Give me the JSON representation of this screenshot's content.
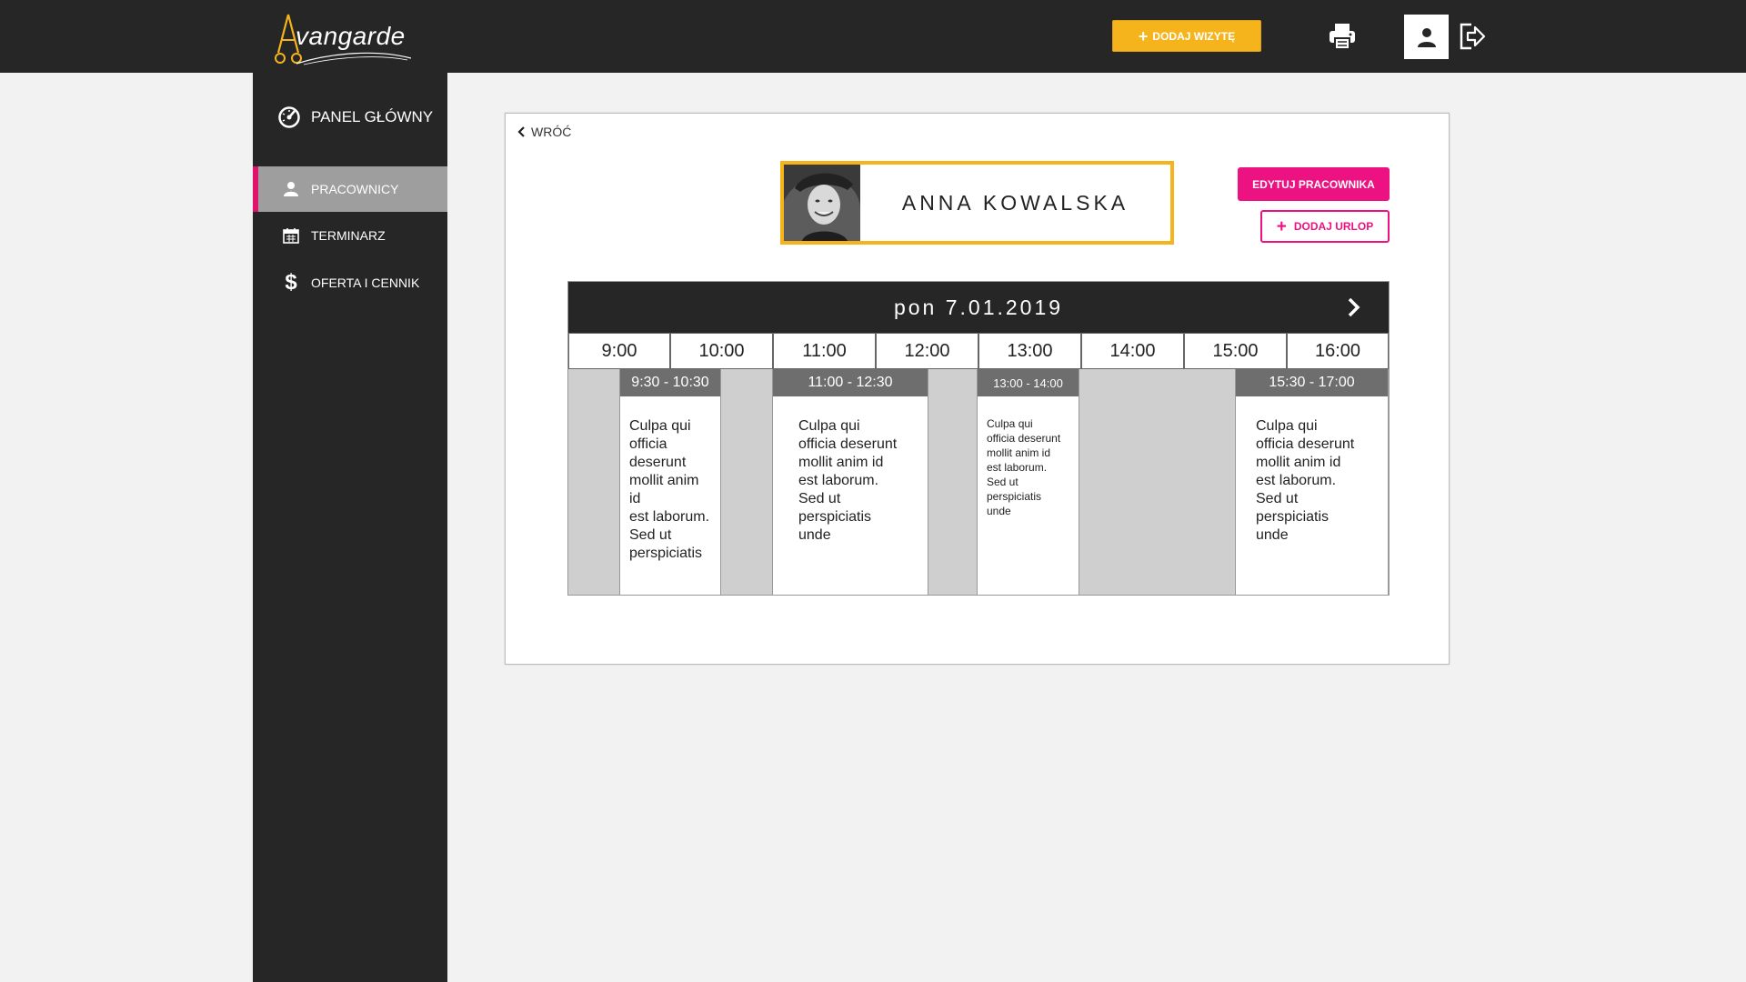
{
  "brand": {
    "name": "vangarde",
    "accent_color": "#f5b41c",
    "pink_color": "#ec1282"
  },
  "header": {
    "add_visit_label": "DODAJ WIZYTĘ",
    "icons": [
      "print-icon",
      "user-icon",
      "logout-icon"
    ]
  },
  "sidebar": {
    "panel_label": "PANEL GŁÓWNY",
    "items": [
      {
        "label": "PRACOWNICY",
        "icon": "person-icon",
        "active": true
      },
      {
        "label": "TERMINARZ",
        "icon": "calendar-icon",
        "active": false
      },
      {
        "label": "OFERTA I CENNIK",
        "icon": "dollar-icon",
        "active": false
      }
    ]
  },
  "card": {
    "back_label": "WRÓĆ",
    "employee_name": "ANNA KOWALSKA",
    "edit_label": "EDYTUJ PRACOWNIKA",
    "add_leave_label": "DODAJ URLOP"
  },
  "schedule": {
    "date": "pon 7.01.2019",
    "hours": [
      "9:00",
      "10:00",
      "11:00",
      "12:00",
      "13:00",
      "14:00",
      "15:00",
      "16:00"
    ],
    "appointments": [
      {
        "time": "9:30 - 10:30",
        "description": "Culpa qui\nofficia\ndeserunt\nmollit anim\nid\nest laborum.\nSed ut\nperspiciatis"
      },
      {
        "time": "11:00 - 12:30",
        "description": "Culpa qui\nofficia deserunt\nmollit anim id\nest laborum.\nSed ut\nperspiciatis\nunde"
      },
      {
        "time": "13:00 - 14:00",
        "description": "Culpa qui\nofficia deserunt\nmollit anim id\nest laborum.\nSed ut\nperspiciatis\nunde"
      },
      {
        "time": "15:30 - 17:00",
        "description": "Culpa qui\nofficia deserunt\nmollit anim id\nest laborum.\nSed ut\nperspiciatis\nunde"
      }
    ]
  }
}
